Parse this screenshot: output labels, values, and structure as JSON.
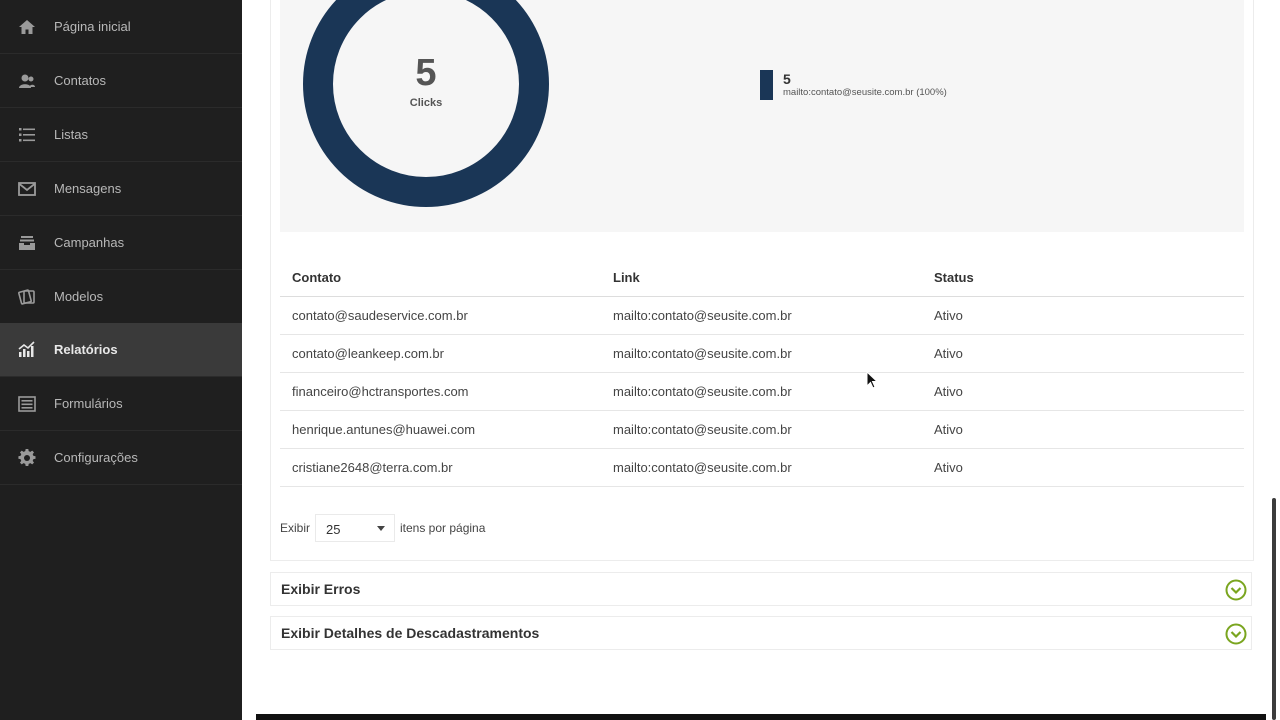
{
  "sidebar": {
    "items": [
      {
        "label": "Página inicial",
        "icon": "home-icon"
      },
      {
        "label": "Contatos",
        "icon": "contacts-icon"
      },
      {
        "label": "Listas",
        "icon": "list-icon"
      },
      {
        "label": "Mensagens",
        "icon": "envelope-icon"
      },
      {
        "label": "Campanhas",
        "icon": "inbox-icon"
      },
      {
        "label": "Modelos",
        "icon": "templates-icon"
      },
      {
        "label": "Relatórios",
        "icon": "chart-icon",
        "active": true
      },
      {
        "label": "Formulários",
        "icon": "form-icon"
      },
      {
        "label": "Configurações",
        "icon": "gear-icon"
      }
    ]
  },
  "summary": {
    "total_value": "5",
    "total_caption": "Clicks",
    "legend": {
      "value": "5",
      "label": "mailto:contato@seusite.com.br (100%)",
      "color": "#1a3656"
    }
  },
  "table": {
    "headers": [
      "Contato",
      "Link",
      "Status"
    ],
    "rows": [
      [
        "contato@saudeservice.com.br",
        "mailto:contato@seusite.com.br",
        "Ativo"
      ],
      [
        "contato@leankeep.com.br",
        "mailto:contato@seusite.com.br",
        "Ativo"
      ],
      [
        "financeiro@hctransportes.com",
        "mailto:contato@seusite.com.br",
        "Ativo"
      ],
      [
        "henrique.antunes@huawei.com",
        "mailto:contato@seusite.com.br",
        "Ativo"
      ],
      [
        "cristiane2648@terra.com.br",
        "mailto:contato@seusite.com.br",
        "Ativo"
      ]
    ]
  },
  "pagination": {
    "prefix": "Exibir",
    "per_page": "25",
    "suffix": "itens por página"
  },
  "accordions": {
    "errors": "Exibir Erros",
    "unsubscribes": "Exibir Detalhes de Descadastramentos"
  },
  "colors": {
    "sidebar_bg": "#1f1f1f",
    "donut": "#1a3656",
    "accent_green": "#7aa51f"
  }
}
